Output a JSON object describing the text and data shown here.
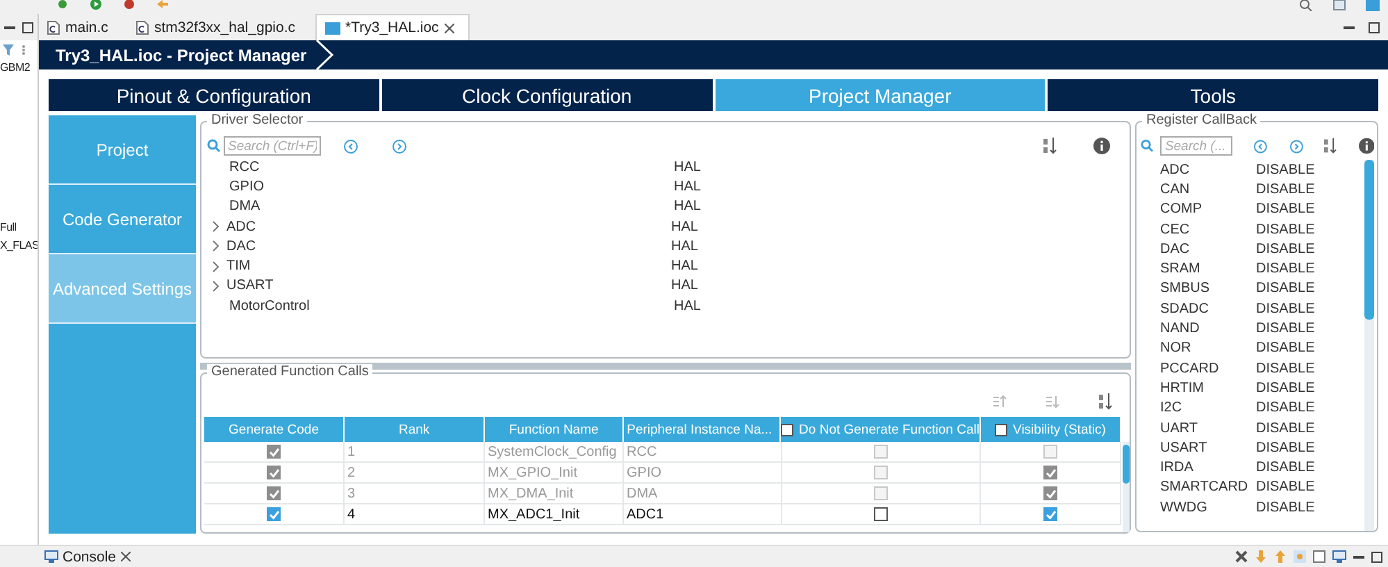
{
  "left_view": {
    "texts": [
      "GBM2",
      "Full",
      "X_FLAS"
    ]
  },
  "editor_tabs": [
    {
      "label": "main.c",
      "selected": false
    },
    {
      "label": "stm32f3xx_hal_gpio.c",
      "selected": false
    },
    {
      "label": "*Try3_HAL.ioc",
      "selected": true
    }
  ],
  "breadcrumb": "Try3_HAL.ioc - Project Manager",
  "main_tabs": [
    {
      "label": "Pinout & Configuration",
      "selected": false
    },
    {
      "label": "Clock Configuration",
      "selected": false
    },
    {
      "label": "Project Manager",
      "selected": true
    },
    {
      "label": "Tools",
      "selected": false
    }
  ],
  "sidebar": {
    "items": [
      {
        "label": "Project",
        "selected": false
      },
      {
        "label": "Code Generator",
        "selected": false
      },
      {
        "label": "Advanced Settings",
        "selected": true
      }
    ]
  },
  "driver_selector": {
    "title": "Driver Selector",
    "placeholder": "Search (Ctrl+F)",
    "rows": [
      {
        "name": "RCC",
        "driver": "HAL",
        "expandable": false
      },
      {
        "name": "GPIO",
        "driver": "HAL",
        "expandable": false
      },
      {
        "name": "DMA",
        "driver": "HAL",
        "expandable": false
      },
      {
        "name": "ADC",
        "driver": "HAL",
        "expandable": true
      },
      {
        "name": "DAC",
        "driver": "HAL",
        "expandable": true
      },
      {
        "name": "TIM",
        "driver": "HAL",
        "expandable": true
      },
      {
        "name": "USART",
        "driver": "HAL",
        "expandable": true
      },
      {
        "name": "MotorControl",
        "driver": "HAL",
        "expandable": false
      }
    ]
  },
  "function_calls": {
    "title": "Generated Function Calls",
    "columns": [
      {
        "label": "Generate Code",
        "kind": "text"
      },
      {
        "label": "Rank",
        "kind": "text"
      },
      {
        "label": "Function Name",
        "kind": "text"
      },
      {
        "label": "Peripheral Instance Na...",
        "kind": "text"
      },
      {
        "label": "Do Not Generate Function Call",
        "kind": "checkbox",
        "checked": false
      },
      {
        "label": "Visibility (Static)",
        "kind": "checkbox",
        "checked": false
      }
    ],
    "rows": [
      {
        "generate_code": true,
        "rank": "1",
        "function": "SystemClock_Config",
        "peripheral": "RCC",
        "do_not_generate": false,
        "visibility": false,
        "disabled": true
      },
      {
        "generate_code": true,
        "rank": "2",
        "function": "MX_GPIO_Init",
        "peripheral": "GPIO",
        "do_not_generate": false,
        "visibility": true,
        "disabled": true
      },
      {
        "generate_code": true,
        "rank": "3",
        "function": "MX_DMA_Init",
        "peripheral": "DMA",
        "do_not_generate": false,
        "visibility": true,
        "disabled": true
      },
      {
        "generate_code": true,
        "rank": "4",
        "function": "MX_ADC1_Init",
        "peripheral": "ADC1",
        "do_not_generate": false,
        "visibility": true,
        "disabled": false
      }
    ]
  },
  "register_callback": {
    "title": "Register CallBack",
    "placeholder": "Search (...",
    "rows": [
      {
        "name": "ADC",
        "value": "DISABLE"
      },
      {
        "name": "CAN",
        "value": "DISABLE"
      },
      {
        "name": "COMP",
        "value": "DISABLE"
      },
      {
        "name": "CEC",
        "value": "DISABLE"
      },
      {
        "name": "DAC",
        "value": "DISABLE"
      },
      {
        "name": "SRAM",
        "value": "DISABLE"
      },
      {
        "name": "SMBUS",
        "value": "DISABLE"
      },
      {
        "name": "SDADC",
        "value": "DISABLE"
      },
      {
        "name": "NAND",
        "value": "DISABLE"
      },
      {
        "name": "NOR",
        "value": "DISABLE"
      },
      {
        "name": "PCCARD",
        "value": "DISABLE"
      },
      {
        "name": "HRTIM",
        "value": "DISABLE"
      },
      {
        "name": "I2C",
        "value": "DISABLE"
      },
      {
        "name": "UART",
        "value": "DISABLE"
      },
      {
        "name": "USART",
        "value": "DISABLE"
      },
      {
        "name": "IRDA",
        "value": "DISABLE"
      },
      {
        "name": "SMARTCARD",
        "value": "DISABLE"
      },
      {
        "name": "WWDG",
        "value": "DISABLE"
      }
    ]
  },
  "console": {
    "label": "Console"
  }
}
